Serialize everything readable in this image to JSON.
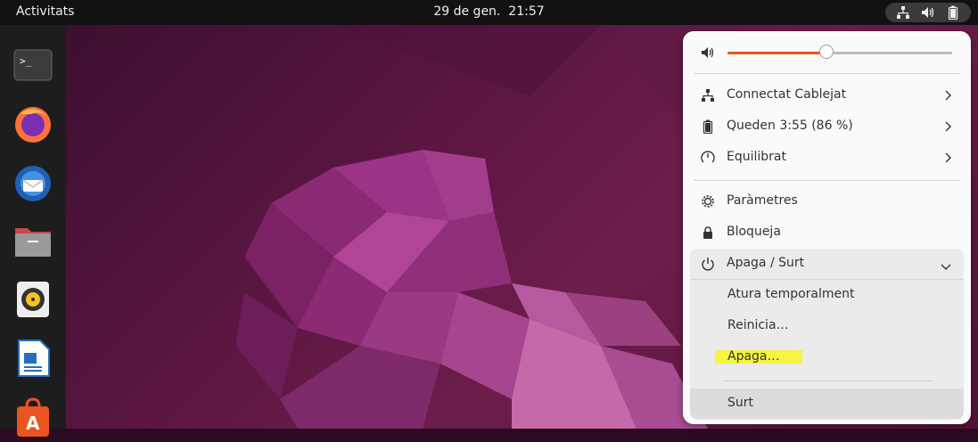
{
  "topbar": {
    "activities": "Activitats",
    "date": "29 de gen.",
    "time": "21:57",
    "tray_icons": [
      "network-wired-icon",
      "volume-icon",
      "battery-icon"
    ]
  },
  "dock": {
    "apps": [
      "terminal-icon",
      "firefox-icon",
      "thunderbird-icon",
      "files-icon",
      "rhythmbox-icon",
      "libreoffice-writer-icon",
      "software-center-icon"
    ]
  },
  "menu": {
    "volume_level_percent": 44,
    "items": [
      {
        "label": "Connectat Cablejat",
        "icon": "network-wired-icon"
      },
      {
        "label": "Queden 3:55 (86 %)",
        "icon": "battery-icon"
      },
      {
        "label": "Equilibrat",
        "icon": "power-profile-icon"
      },
      {
        "label": "Paràmetres",
        "icon": "settings-icon"
      },
      {
        "label": "Bloqueja",
        "icon": "lock-icon"
      },
      {
        "label": "Apaga / Surt",
        "icon": "power-icon"
      }
    ],
    "power_submenu": [
      {
        "label": "Atura temporalment"
      },
      {
        "label": "Reinicia…"
      },
      {
        "label": "Apaga…"
      },
      {
        "label": "Surt"
      }
    ],
    "accent_color": "#e95420",
    "highlight_color": "#f5f542"
  }
}
